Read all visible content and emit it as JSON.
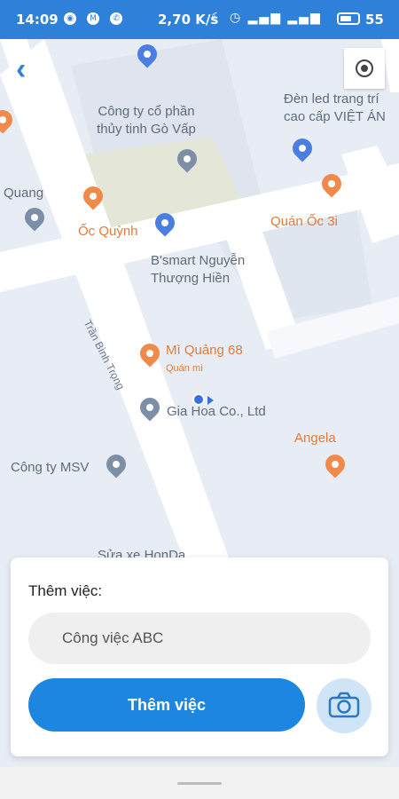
{
  "status_bar": {
    "time": "14:09",
    "network_speed": "2,70 K/s",
    "battery_level": "55"
  },
  "map": {
    "pois": [
      {
        "id": "poi-glass",
        "text": "Công ty cổ phần thủy tinh Gò Vấp",
        "color": "grey"
      },
      {
        "id": "poi-led",
        "text": "Đèn led trang trí cao cấp VIỆT ÁN",
        "color": "grey"
      },
      {
        "id": "poi-quang",
        "text": "Quang",
        "color": "grey"
      },
      {
        "id": "poi-oc-quynh",
        "text": "Ốc Quỳnh",
        "color": "orange"
      },
      {
        "id": "poi-quan-oc",
        "text": "Quán Ốc 3i",
        "color": "orange"
      },
      {
        "id": "poi-bsmart",
        "text": "B'smart Nguyễn Thượng Hiền",
        "color": "grey"
      },
      {
        "id": "poi-mi-quang",
        "text": "Mì Quảng 68",
        "color": "orange"
      },
      {
        "id": "poi-mi-quang-sub",
        "text": "Quán mì",
        "color": "orange"
      },
      {
        "id": "poi-gia-hoa",
        "text": "Gia Hoa Co., Ltd",
        "color": "grey"
      },
      {
        "id": "poi-angela",
        "text": "Angela",
        "color": "orange"
      },
      {
        "id": "poi-msv",
        "text": "Công ty MSV",
        "color": "grey"
      },
      {
        "id": "poi-honda",
        "text": "Sửa xe HonDa",
        "color": "grey"
      }
    ],
    "street": "Trần Bình Trọng",
    "colors": {
      "road": "#ffffff",
      "background": "#e8edf5",
      "accent": "#2f80d8"
    }
  },
  "task_card": {
    "label": "Thêm việc:",
    "input_value": "Công việc ABC",
    "submit_label": "Thêm việc",
    "camera_icon": "camera-icon"
  }
}
